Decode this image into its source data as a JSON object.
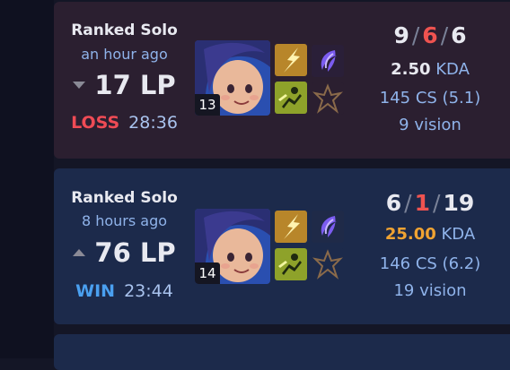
{
  "colors": {
    "loss": "#ef4b55",
    "win": "#4aa0f0",
    "deaths": "#ef5350",
    "great_kda": "#f0a332"
  },
  "matches": [
    {
      "queue": "Ranked Solo",
      "time_ago": "an hour ago",
      "lp_change": "17 LP",
      "lp_direction": "down",
      "result": "LOSS",
      "duration": "28:36",
      "champion_level": "13",
      "kills": "9",
      "deaths": "6",
      "assists": "6",
      "kda_ratio": "2.50",
      "kda_label": "KDA",
      "cs": "145 CS (5.1)",
      "vision": "9 vision",
      "spells": [
        "flash-spell-icon",
        "ignite-spell-icon"
      ],
      "runes": [
        "electrocute-rune-icon",
        "sorcery-rune-icon"
      ]
    },
    {
      "queue": "Ranked Solo",
      "time_ago": "8 hours ago",
      "lp_change": "76 LP",
      "lp_direction": "up",
      "result": "WIN",
      "duration": "23:44",
      "champion_level": "14",
      "kills": "6",
      "deaths": "1",
      "assists": "19",
      "kda_ratio": "25.00",
      "kda_label": "KDA",
      "cs": "146 CS (6.2)",
      "vision": "19 vision",
      "spells": [
        "flash-spell-icon",
        "ignite-spell-icon"
      ],
      "runes": [
        "electrocute-rune-icon",
        "sorcery-rune-icon"
      ]
    }
  ]
}
